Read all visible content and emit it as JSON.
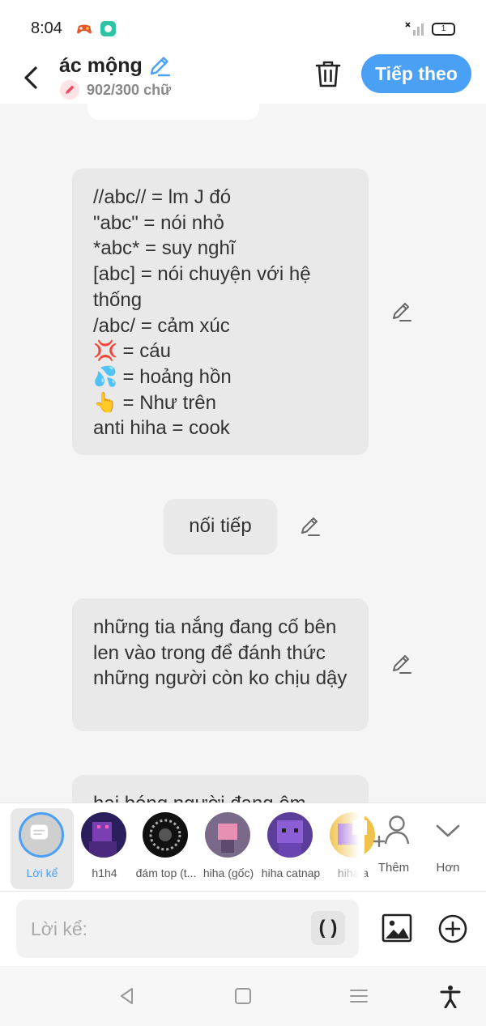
{
  "status_bar": {
    "time": "8:04",
    "battery": "1"
  },
  "header": {
    "title": "ác mộng",
    "word_count": "902/300 chữ",
    "next_label": "Tiếp theo"
  },
  "messages": [
    {
      "text": "//abc// = lm J đó\n\"abc\" = nói nhỏ\n*abc* = suy nghĩ\n[abc] = nói chuyện với hệ thống\n/abc/ = cảm xúc\n💢 = cáu\n💦 = hoảng hồn\n👆 = Như trên\nanti hiha = cook"
    },
    {
      "text": "nối tiếp"
    },
    {
      "text": "những tia nắng đang cố bên len vào trong để đánh thức những người còn ko chịu dậy"
    },
    {
      "text": "hai bóng người đang ôm"
    }
  ],
  "characters": [
    {
      "name": "Lời kể",
      "active": true
    },
    {
      "name": "h1h4"
    },
    {
      "name": "đám top (t..."
    },
    {
      "name": "hiha (gốc)"
    },
    {
      "name": "hiha catnap"
    },
    {
      "name": "hiha a"
    }
  ],
  "tools": {
    "add_label": "Thêm",
    "more_label": "Hơn"
  },
  "input": {
    "placeholder": "Lời kể:",
    "paren_label": "( )"
  },
  "colors": {
    "accent": "#4aa0f5",
    "bubble": "#e9e9e9",
    "background": "#f5f5f5"
  },
  "icons": {
    "back": "chevron-left-icon",
    "title_edit": "pencil-icon",
    "delete": "trash-icon",
    "message_edit": "pencil-icon",
    "add_character": "person-add-icon",
    "more": "chevron-down-icon",
    "image": "image-icon",
    "add": "plus-circle-icon"
  }
}
